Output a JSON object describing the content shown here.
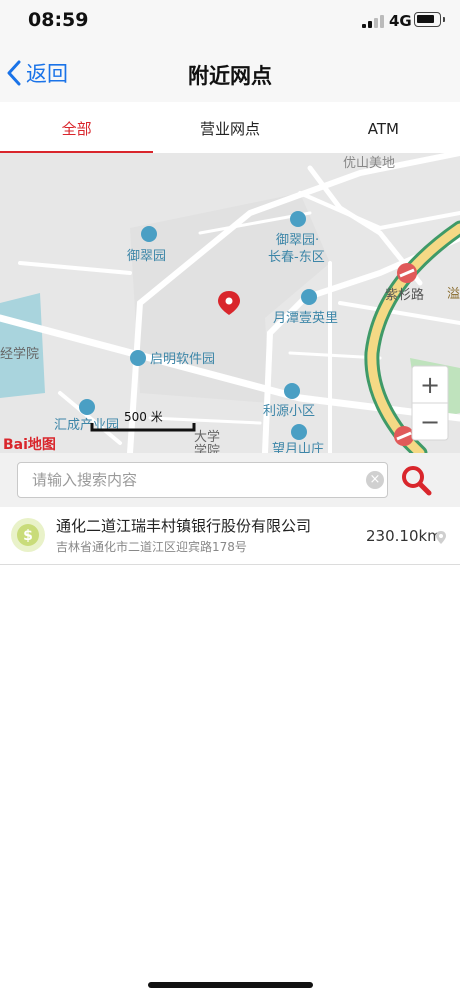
{
  "status": {
    "time": "08:59",
    "network": "4G"
  },
  "nav": {
    "back_label": "返回",
    "title": "附近网点"
  },
  "tabs": [
    {
      "label": "全部",
      "active": true
    },
    {
      "label": "营业网点",
      "active": false
    },
    {
      "label": "ATM",
      "active": false
    }
  ],
  "map": {
    "pois": [
      "优山美地",
      "御翠园",
      "御翠园·",
      "长春-东区",
      "紫杉路",
      "溢",
      "月潭壹英里",
      "经学院",
      "启明软件园",
      "利源小区",
      "汇成产业园",
      "大学",
      "学院",
      "望月山庄"
    ],
    "scale_label": "500 米",
    "logo": "Bai地图",
    "zoom_in": "+",
    "zoom_out": "−"
  },
  "search": {
    "placeholder": "请输入搜索内容"
  },
  "results": [
    {
      "name": "通化二道江瑞丰村镇银行股份有限公司",
      "address": "吉林省通化市二道江区迎宾路178号",
      "distance": "230.10km"
    }
  ],
  "colors": {
    "accent_red": "#d9262c",
    "link_blue": "#1a73e8",
    "poi_blue": "#3d86a8",
    "road_green": "#3f9a68"
  }
}
